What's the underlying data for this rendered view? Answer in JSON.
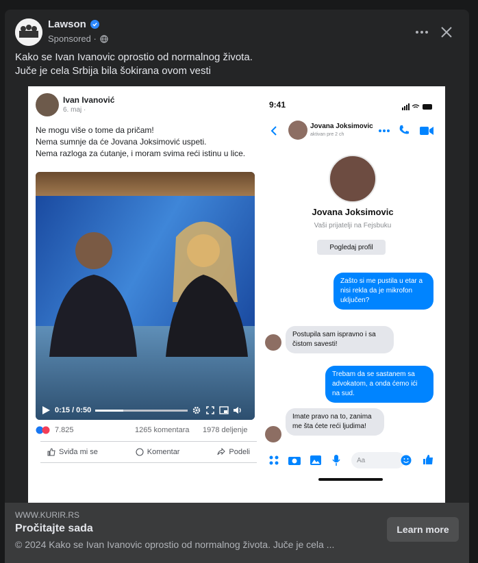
{
  "post": {
    "page_name": "Lawson",
    "sponsored_label": "Sponsored ·",
    "text_line1": "Kako se Ivan Ivanovic oprostio od normalnog života.",
    "text_line2": "Juče je cela Srbija bila šokirana ovom vesti"
  },
  "media": {
    "left_post": {
      "author": "Ivan Ivanović",
      "date": "6. maj ·",
      "line1": "Ne mogu više o tome da pričam!",
      "line2": "Nema sumnje da će Jovana Joksimović uspeti.",
      "line3": "Nema razloga za ćutanje, i moram svima reći istinu u lice.",
      "video_time": "0:15 / 0:50",
      "video_progress": 0.3,
      "reactions_count": "7.825",
      "comments_count": "1265 komentara",
      "shares_count": "1978 deljenje",
      "like_label": "Sviđa mi se",
      "comment_label": "Komentar",
      "share_label": "Podeli"
    },
    "phone": {
      "time": "9:41",
      "contact_name": "Jovana Joksimovic",
      "contact_status": "aktivan pre 2 ch",
      "profile_name": "Jovana Joksimovic",
      "friends_text": "Vaši prijatelji na Fejsbuku",
      "profile_button": "Pogledaj profil",
      "msg1": "Zašto si me pustila u etar a nisi rekla da je mikrofon uključen?",
      "msg2": "Postupila sam ispravno i sa čistom savesti!",
      "msg3": "Trebam da se sastanem sa advokatom, a onda ćemo ići na sud.",
      "msg4": "Imate pravo na to, zanima me šta ćete reći ljudima!",
      "compose_placeholder": "Aa"
    }
  },
  "footer": {
    "domain": "WWW.KURIR.RS",
    "title": "Pročitajte sada",
    "description": "© 2024 Kako se Ivan Ivanovic oprostio od normalnog života. Juče je cela ...",
    "cta": "Learn more"
  },
  "colors": {
    "background": "#242526",
    "accent": "#0084ff",
    "verified": "#2d88ff"
  }
}
